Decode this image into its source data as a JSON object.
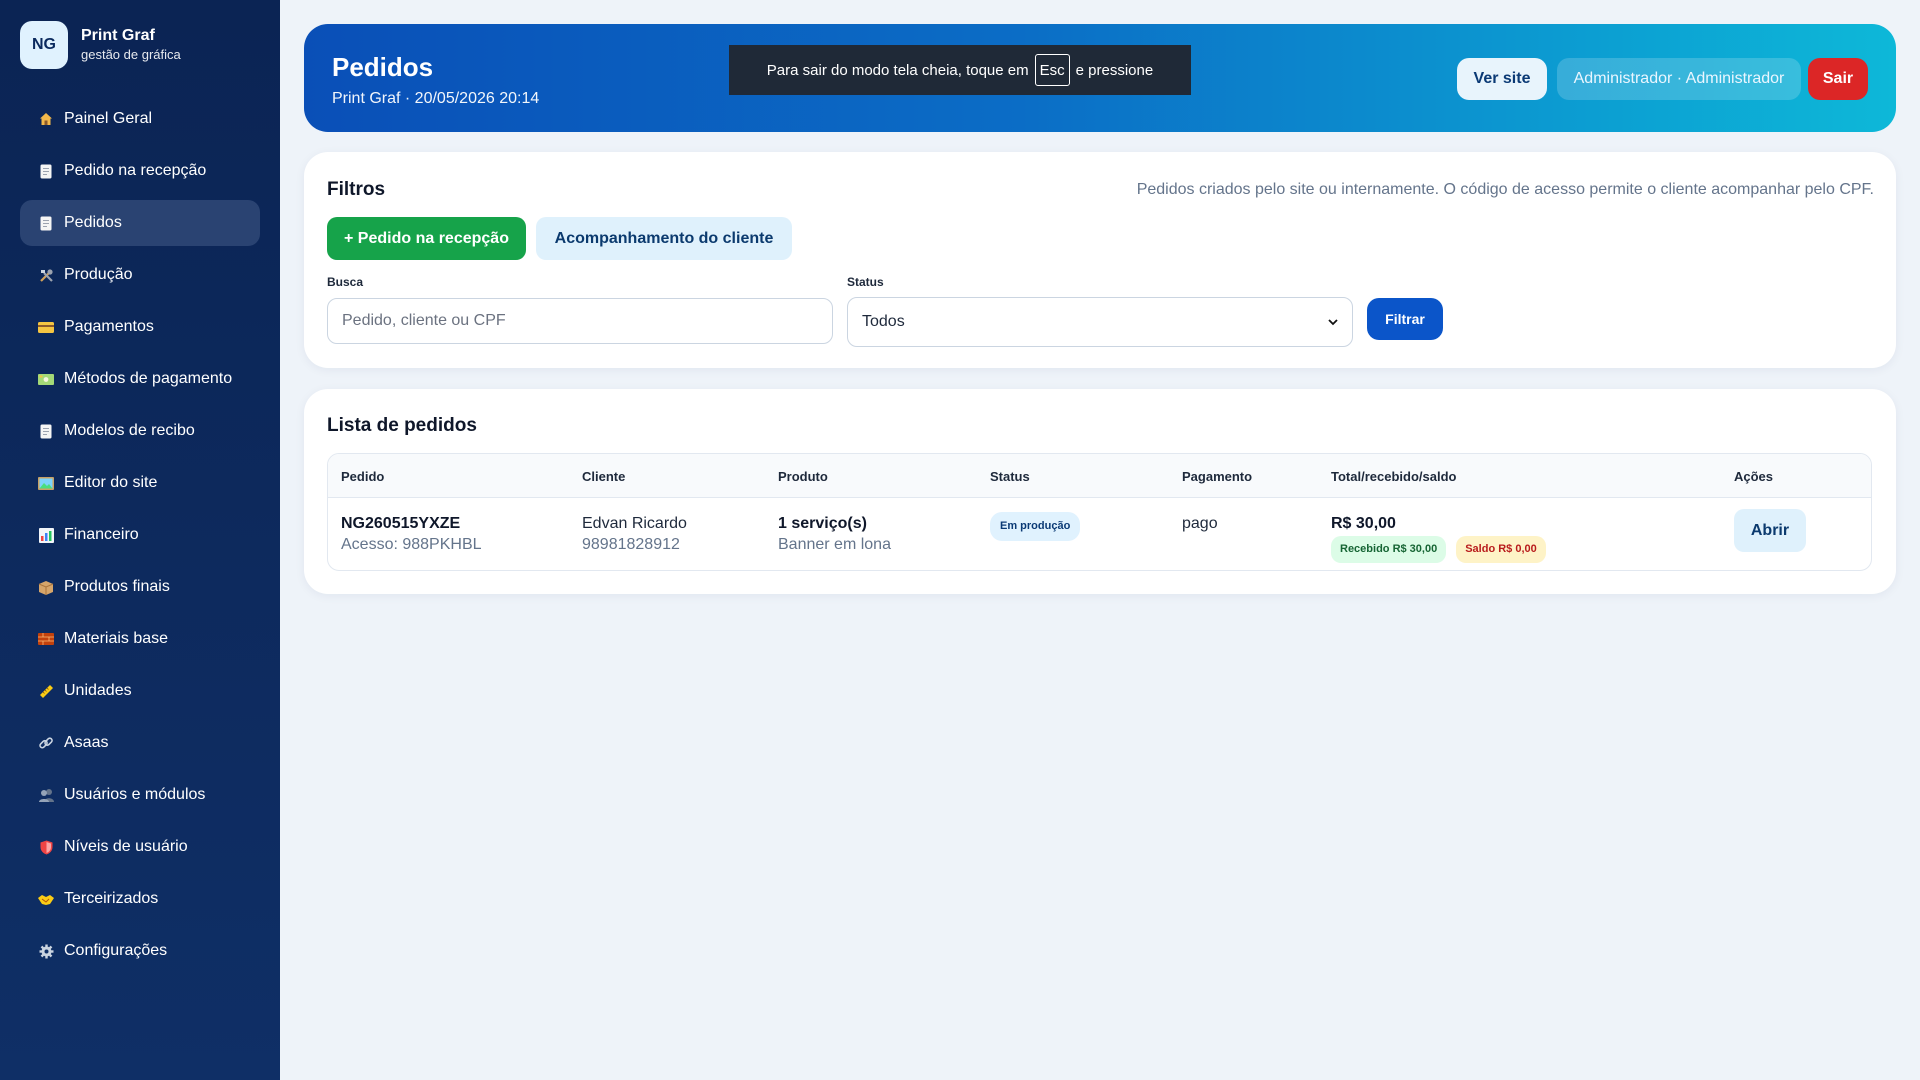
{
  "brand": {
    "logo_text": "NG",
    "name": "Print Graf",
    "subtitle": "gestão de gráfica"
  },
  "sidebar": {
    "items": [
      {
        "label": "Painel Geral",
        "icon": "home-icon"
      },
      {
        "label": "Pedido na recepção",
        "icon": "document-icon"
      },
      {
        "label": "Pedidos",
        "icon": "document-icon",
        "active": true
      },
      {
        "label": "Produção",
        "icon": "tools-icon"
      },
      {
        "label": "Pagamentos",
        "icon": "card-icon"
      },
      {
        "label": "Métodos de pagamento",
        "icon": "money-icon"
      },
      {
        "label": "Modelos de recibo",
        "icon": "document-icon"
      },
      {
        "label": "Editor do site",
        "icon": "picture-icon"
      },
      {
        "label": "Financeiro",
        "icon": "chart-icon"
      },
      {
        "label": "Produtos finais",
        "icon": "box-icon"
      },
      {
        "label": "Materiais base",
        "icon": "brick-icon"
      },
      {
        "label": "Unidades",
        "icon": "ruler-icon"
      },
      {
        "label": "Asaas",
        "icon": "link-icon"
      },
      {
        "label": "Usuários e módulos",
        "icon": "users-icon"
      },
      {
        "label": "Níveis de usuário",
        "icon": "shield-icon"
      },
      {
        "label": "Terceirizados",
        "icon": "handshake-icon"
      },
      {
        "label": "Configurações",
        "icon": "gear-icon"
      }
    ]
  },
  "header": {
    "title": "Pedidos",
    "subtitle": "Print Graf · 20/05/2026 20:14",
    "fullscreen_notice_before": "Para sair do modo tela cheia, toque em",
    "fullscreen_key": "Esc",
    "fullscreen_notice_after": "e pressione",
    "view_site_label": "Ver site",
    "user_label": "Administrador · Administrador",
    "exit_label": "Sair"
  },
  "filters": {
    "title": "Filtros",
    "note": "Pedidos criados pelo site ou internamente. O código de acesso permite o cliente acompanhar pelo CPF.",
    "new_order_label": "+ Pedido na recepção",
    "tracking_label": "Acompanhamento do cliente",
    "search_label": "Busca",
    "search_placeholder": "Pedido, cliente ou CPF",
    "search_value": "",
    "status_label": "Status",
    "status_value": "Todos",
    "filter_button": "Filtrar"
  },
  "orders": {
    "title": "Lista de pedidos",
    "columns": [
      "Pedido",
      "Cliente",
      "Produto",
      "Status",
      "Pagamento",
      "Total/recebido/saldo",
      "Ações"
    ],
    "rows": [
      {
        "code": "NG260515YXZE",
        "access": "Acesso: 988PKHBL",
        "client": "Edvan Ricardo",
        "phone": "98981828912",
        "product": "1 serviço(s)",
        "product_detail": "Banner em lona",
        "status": "Em produção",
        "payment": "pago",
        "total": "R$ 30,00",
        "received": "Recebido R$ 30,00",
        "balance": "Saldo R$ 0,00",
        "action": "Abrir"
      }
    ]
  },
  "colors": {
    "sidebar_bg": "#0b2454",
    "header_gradient_start": "#0a4fb7",
    "header_gradient_end": "#0db8d8",
    "success": "#16a34a",
    "danger": "#dc2626",
    "primary": "#0b55c9"
  }
}
